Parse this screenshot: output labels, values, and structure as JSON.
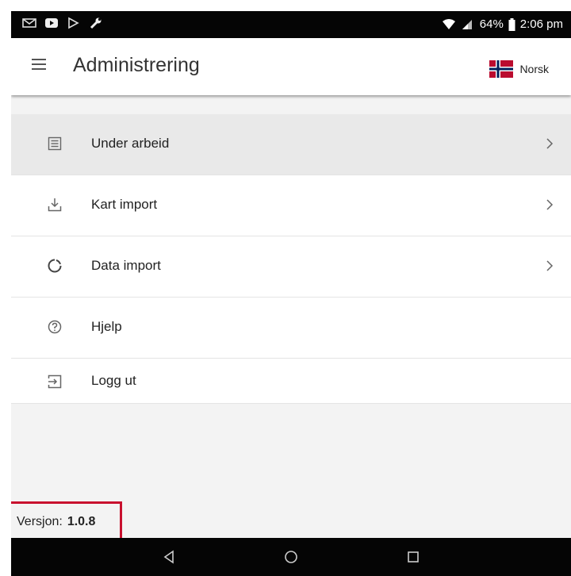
{
  "status_bar": {
    "battery": "64%",
    "time": "2:06 pm",
    "icons": [
      "mail-icon",
      "youtube-icon",
      "play-icon",
      "wrench-icon",
      "wifi-icon",
      "signal-icon",
      "battery-icon"
    ]
  },
  "app_bar": {
    "title": "Administrering",
    "language": "Norsk",
    "menu_icon": "hamburger-icon",
    "flag_icon": "norway-flag-icon"
  },
  "menu": {
    "items": [
      {
        "label": "Under arbeid",
        "icon": "list-icon",
        "has_chevron": true,
        "active": true
      },
      {
        "label": "Kart import",
        "icon": "download-icon",
        "has_chevron": true,
        "active": false
      },
      {
        "label": "Data import",
        "icon": "progress-circle-icon",
        "has_chevron": true,
        "active": false
      },
      {
        "label": "Hjelp",
        "icon": "help-icon",
        "has_chevron": false,
        "active": false
      },
      {
        "label": "Logg ut",
        "icon": "logout-icon",
        "has_chevron": false,
        "active": false
      }
    ]
  },
  "footer": {
    "version_label": "Versjon:",
    "version_value": "1.0.8"
  },
  "colors": {
    "highlight": "#c8102e",
    "active_row": "#e9e9e9",
    "system_bar": "#050505"
  }
}
